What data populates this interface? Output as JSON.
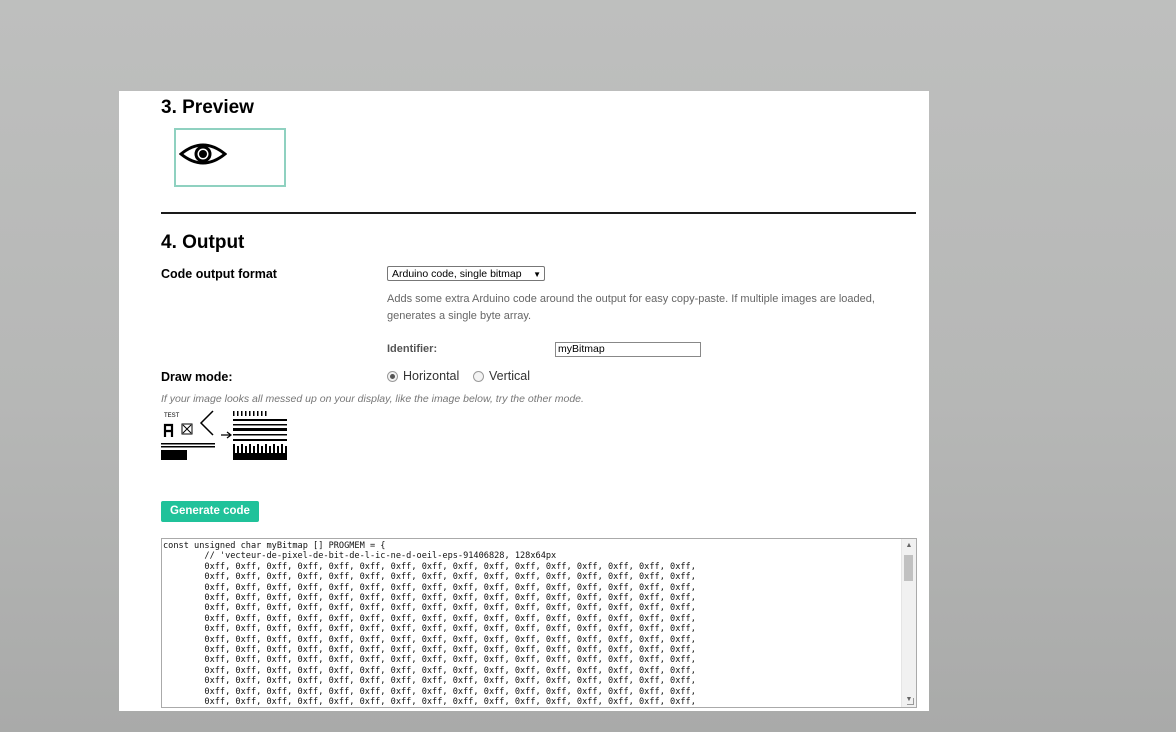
{
  "preview": {
    "heading": "3. Preview"
  },
  "output": {
    "heading": "4. Output",
    "format_label": "Code output format",
    "format_selected": "Arduino code, single bitmap",
    "format_description": "Adds some extra Arduino code around the output for easy copy-paste. If multiple images are loaded, generates a single byte array.",
    "identifier_label": "Identifier:",
    "identifier_value": "myBitmap",
    "draw_mode_label": "Draw mode:",
    "draw_mode_options": [
      "Horizontal",
      "Vertical"
    ],
    "draw_mode_selected": "Horizontal",
    "hint": "If your image looks all messed up on your display, like the image below, try the other mode.",
    "example_label": "TEST",
    "generate_button": "Generate code",
    "code_header": "const unsigned char myBitmap [] PROGMEM = {",
    "code_comment": "        // 'vecteur-de-pixel-de-bit-de-l-ic-ne-d-oeil-eps-91406828, 128x64px",
    "code_row": "        0xff, 0xff, 0xff, 0xff, 0xff, 0xff, 0xff, 0xff, 0xff, 0xff, 0xff, 0xff, 0xff, 0xff, 0xff, 0xff,"
  },
  "colors": {
    "accent": "#20c29a",
    "preview_border": "#8fd1c0"
  },
  "icons": [
    "eye-icon",
    "select-arrow-icon",
    "scroll-up-icon",
    "scroll-down-icon"
  ]
}
